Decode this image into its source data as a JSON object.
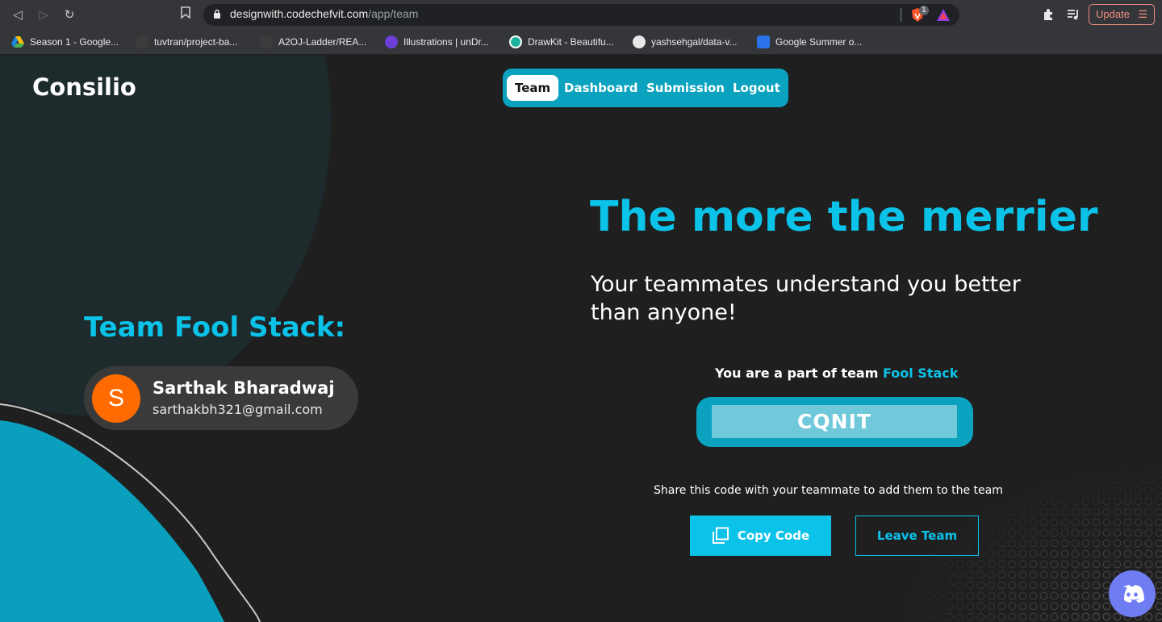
{
  "browser": {
    "url_host": "designwith.codechefvit.com",
    "url_path": "/app/team",
    "extension_badge": "1",
    "update_label": "Update",
    "bookmarks": [
      {
        "label": "Season 1 - Google...",
        "icon": "google-drive-icon"
      },
      {
        "label": "tuvtran/project-ba...",
        "icon": "github-icon"
      },
      {
        "label": "A2OJ-Ladder/REA...",
        "icon": "github-icon"
      },
      {
        "label": "Illustrations | unDr...",
        "icon": "undraw-icon"
      },
      {
        "label": "DrawKit - Beautifu...",
        "icon": "drawkit-icon"
      },
      {
        "label": "yashsehgal/data-v...",
        "icon": "github-icon"
      },
      {
        "label": "Google Summer o...",
        "icon": "gsoc-icon"
      }
    ]
  },
  "app": {
    "logo": "Consilio",
    "nav": [
      {
        "label": "Team",
        "active": true
      },
      {
        "label": "Dashboard",
        "active": false
      },
      {
        "label": "Submission",
        "active": false
      },
      {
        "label": "Logout",
        "active": false
      }
    ]
  },
  "team": {
    "title": "Team Fool Stack:",
    "members": [
      {
        "initial": "S",
        "name": "Sarthak Bharadwaj",
        "email": "sarthakbh321@gmail.com",
        "avatar_color": "#ff6b00"
      }
    ]
  },
  "hero": {
    "headline": "The more the merrier",
    "subline": "Your teammates understand you better than anyone!"
  },
  "invite": {
    "prefix": "You are a part of team",
    "team_name": "Fool Stack",
    "code": "CQNIT",
    "share_text": "Share this code with your teammate to add them to the team",
    "copy_label": "Copy Code",
    "leave_label": "Leave Team"
  },
  "colors": {
    "accent": "#0bc2e8",
    "pill": "#0aa2bf",
    "background": "#1f1f1f"
  }
}
